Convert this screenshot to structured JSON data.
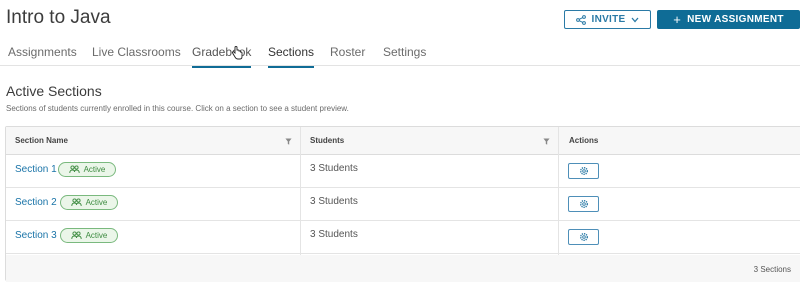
{
  "header": {
    "title": "Intro to Java",
    "invite_label": "INVITE",
    "new_assignment_label": "NEW ASSIGNMENT"
  },
  "tabs": [
    "Assignments",
    "Live Classrooms",
    "Gradebook",
    "Sections",
    "Roster",
    "Settings"
  ],
  "active_tab": "Sections",
  "main": {
    "title": "Active Sections",
    "subtitle": "Sections of students currently enrolled in this course. Click on a section to see a student preview."
  },
  "table": {
    "columns": [
      "Section Name",
      "Students",
      "Actions"
    ],
    "rows": [
      {
        "name": "Section 1",
        "status": "Active",
        "students": "3 Students"
      },
      {
        "name": "Section 2",
        "status": "Active",
        "students": "3 Students"
      },
      {
        "name": "Section 3",
        "status": "Active",
        "students": "3 Students"
      }
    ],
    "footer_count": "3 Sections"
  },
  "colors": {
    "primary": "#0f6c96",
    "link": "#1a74a8",
    "active_badge": "#3d8b40"
  },
  "icons": {
    "invite": "share-icon",
    "invite_chevron": "chevron-down-icon",
    "new": "plus-icon",
    "filter": "filter-icon",
    "badge": "group-icon",
    "action": "gear-icon"
  }
}
